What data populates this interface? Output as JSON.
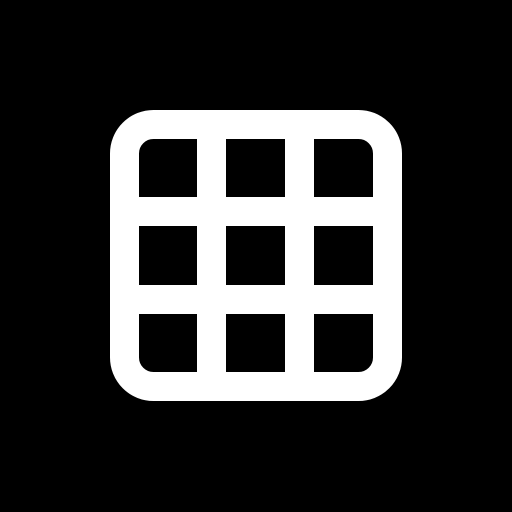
{
  "icon": {
    "name": "grid-icon",
    "foreground": "#ffffff",
    "background": "#000000",
    "grid_rows": 3,
    "grid_cols": 3
  }
}
